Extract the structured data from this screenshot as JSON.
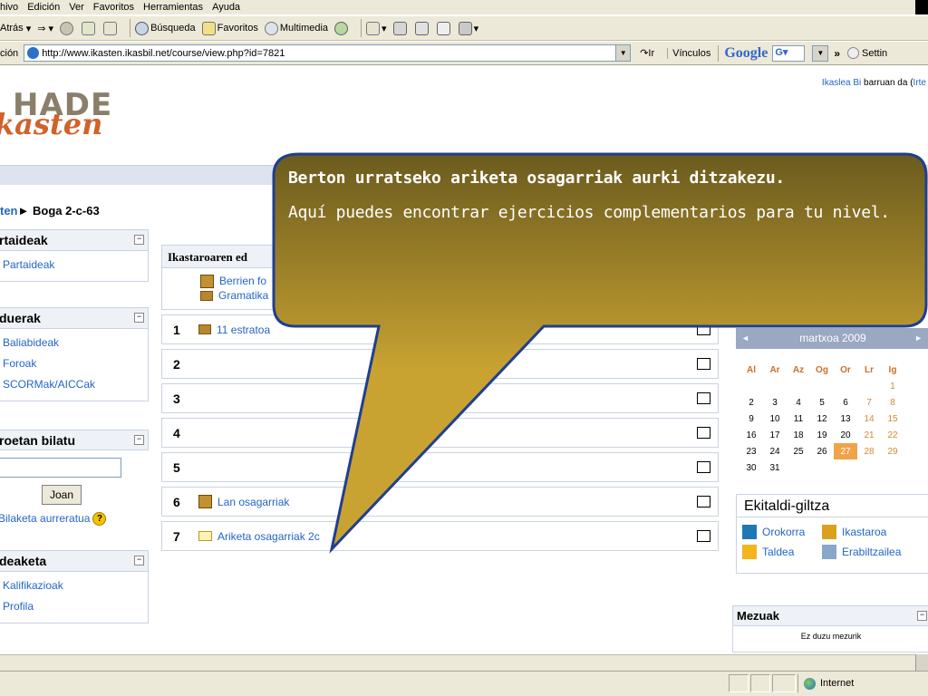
{
  "menubar": [
    "hivo",
    "Edición",
    "Ver",
    "Favoritos",
    "Herramientas",
    "Ayuda"
  ],
  "toolbar": {
    "back": "Atrás",
    "search": "Búsqueda",
    "favorites": "Favoritos",
    "media": "Multimedia"
  },
  "address": {
    "label": "ción",
    "url": "http://www.ikasten.ikasbil.net/course/view.php?id=7821",
    "go": "Ir",
    "links": "Vínculos",
    "google": "Google",
    "google_btn": "G",
    "more": "»",
    "settings": "Settin"
  },
  "logo": {
    "top": "HADE",
    "bottom": "kasten"
  },
  "login": {
    "user": "Ikaslea Bi",
    "text": " barruan da (",
    "link": "Irte"
  },
  "breadcrumb": {
    "link": "ten",
    "sep": "► ",
    "current": "Boga 2-c-63"
  },
  "blocks": {
    "participants": {
      "title": "rtaideak",
      "items": [
        "Partaideak"
      ]
    },
    "activities": {
      "title": "duerak",
      "items": [
        "Baliabideak",
        "Foroak",
        "SCORMak/AICCak"
      ]
    },
    "search": {
      "title": "roetan bilatu",
      "button": "Joan",
      "advanced": "Bilaketa aurreratua",
      "help": "?"
    },
    "admin": {
      "title": "deaketa",
      "items": [
        "Kalifikazioak",
        "Profila"
      ]
    },
    "minimize": "−"
  },
  "center": {
    "header": "Ikastaroaren ed",
    "topic0": [
      "Berrien fo",
      "Gramatika"
    ],
    "topics": [
      {
        "num": "1",
        "icon": "box-icon",
        "label": "11 estratoa"
      },
      {
        "num": "2",
        "icon": "",
        "label": ""
      },
      {
        "num": "3",
        "icon": "",
        "label": ""
      },
      {
        "num": "4",
        "icon": "",
        "label": ""
      },
      {
        "num": "5",
        "icon": "",
        "label": ""
      },
      {
        "num": "6",
        "icon": "people-icon",
        "label": "Lan osagarriak"
      },
      {
        "num": "7",
        "icon": "folder-icon",
        "label": "Ariketa osagarriak 2c"
      }
    ]
  },
  "calendar": {
    "month": "martxoa 2009",
    "prev": "◄",
    "next": "►",
    "days": [
      "Al",
      "Ar",
      "Az",
      "Og",
      "Or",
      "Lr",
      "Ig"
    ],
    "weeks": [
      [
        "",
        "",
        "",
        "",
        "",
        "",
        "1"
      ],
      [
        "2",
        "3",
        "4",
        "5",
        "6",
        "7",
        "8"
      ],
      [
        "9",
        "10",
        "11",
        "12",
        "13",
        "14",
        "15"
      ],
      [
        "16",
        "17",
        "18",
        "19",
        "20",
        "21",
        "22"
      ],
      [
        "23",
        "24",
        "25",
        "26",
        "27",
        "28",
        "29"
      ],
      [
        "30",
        "31",
        "",
        "",
        "",
        "",
        ""
      ]
    ],
    "today": "27"
  },
  "legend": {
    "title": "Ekitaldi-giltza",
    "items": [
      {
        "label": "Orokorra",
        "color": "#1f77b4"
      },
      {
        "label": "Ikastaroa",
        "color": "#d9a11e"
      },
      {
        "label": "Taldea",
        "color": "#f2b51c"
      },
      {
        "label": "Erabiltzailea",
        "color": "#8aa6c8"
      }
    ]
  },
  "messages": {
    "title": "Mezuak",
    "body": "Ez duzu mezurik"
  },
  "status": {
    "zone": "Internet"
  },
  "callout": {
    "line1": "Berton urratseko ariketa osagarriak aurki ditzakezu.",
    "line2": "Aquí puedes encontrar ejercicios complementarios para tu nivel."
  },
  "colors": {
    "link": "#2366c6",
    "callout_border": "#1f3f8f",
    "callout_top": "#6b5b1e",
    "callout_bottom": "#c9a332"
  }
}
